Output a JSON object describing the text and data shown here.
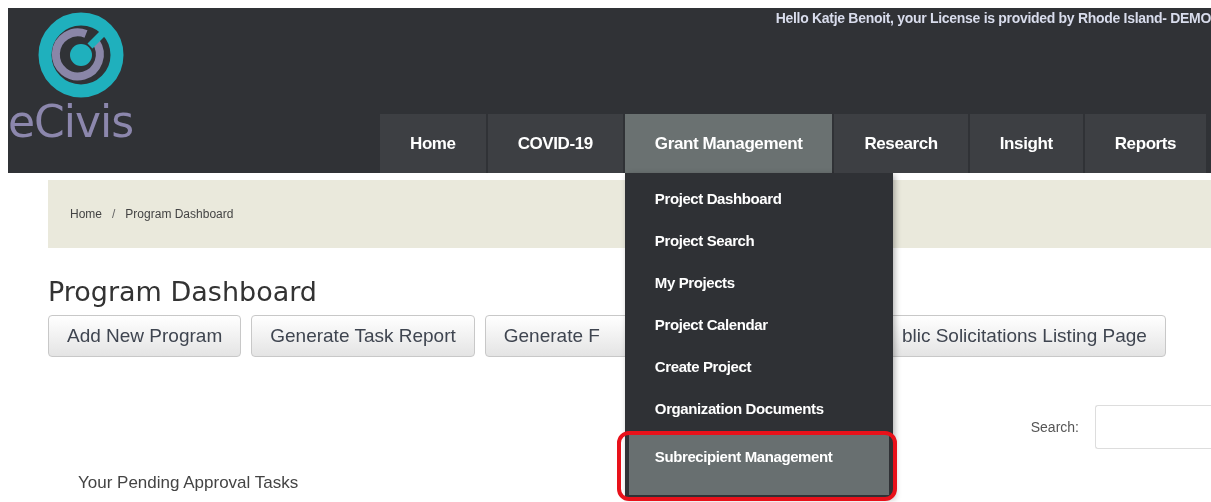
{
  "header": {
    "greeting": "Hello Katje Benoit, your License is provided by Rhode Island- DEMO",
    "logo_text": "eCivis"
  },
  "nav": [
    {
      "label": "Home",
      "selected": false
    },
    {
      "label": "COVID-19",
      "selected": false
    },
    {
      "label": "Grant Management",
      "selected": true,
      "menu": [
        {
          "label": "Project Dashboard",
          "selected": false
        },
        {
          "label": "Project Search",
          "selected": false
        },
        {
          "label": "My Projects",
          "selected": false
        },
        {
          "label": "Project Calendar",
          "selected": false
        },
        {
          "label": "Create Project",
          "selected": false
        },
        {
          "label": "Organization Documents",
          "selected": false
        },
        {
          "label": "Subrecipient Management",
          "selected": true
        }
      ]
    },
    {
      "label": "Research",
      "selected": false
    },
    {
      "label": "Insight",
      "selected": false
    },
    {
      "label": "Reports",
      "selected": false
    }
  ],
  "breadcrumb": {
    "items": [
      "Home",
      "Program Dashboard"
    ],
    "separator": "/"
  },
  "title": "Program Dashboard",
  "buttons": [
    "Add New Program",
    "Generate Task Report",
    "Generate F",
    "blic Solicitations Listing Page"
  ],
  "search": {
    "label": "Search:"
  },
  "section_heading": "Your Pending Approval Tasks"
}
